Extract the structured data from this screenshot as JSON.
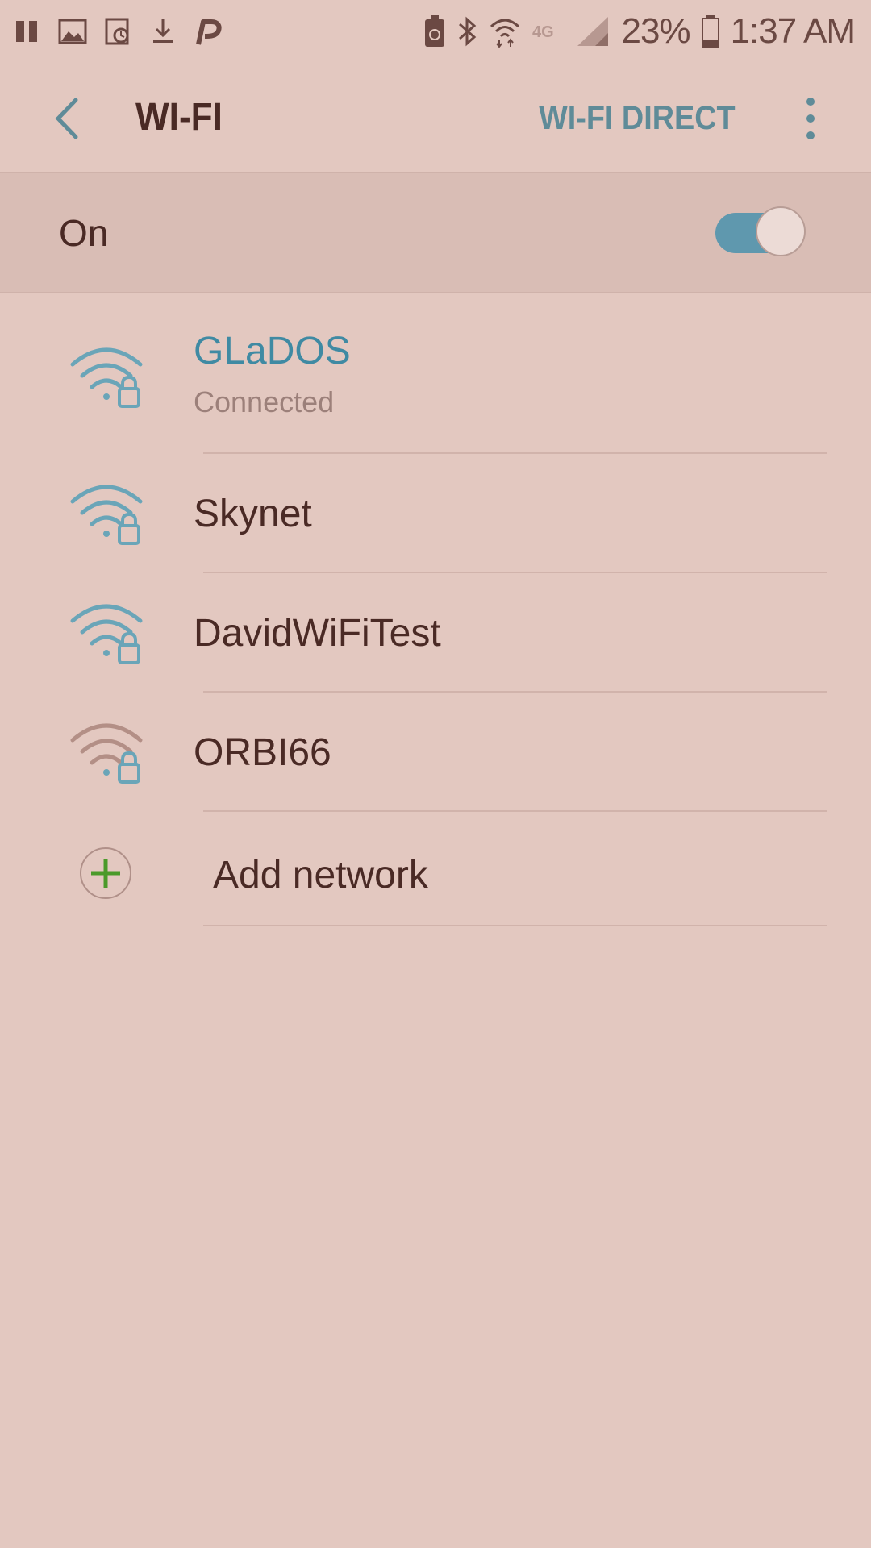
{
  "status_bar": {
    "left_icons": [
      "pause-icon",
      "gallery-icon",
      "sync-icon",
      "download-icon",
      "parking-icon"
    ],
    "right_icons": [
      "battery-saver-icon",
      "bluetooth-icon",
      "wifi-signal-icon",
      "4g-icon",
      "cell-signal-icon"
    ],
    "network_type": "4G",
    "battery_percent": "23%",
    "time": "1:37 AM"
  },
  "app_bar": {
    "back_icon": "chevron-left-icon",
    "title": "WI-FI",
    "wifi_direct_label": "WI-FI DIRECT",
    "more_icon": "vertical-dots-icon"
  },
  "toggle": {
    "label": "On",
    "state": true
  },
  "networks": [
    {
      "name": "GLaDOS",
      "status": "Connected",
      "connected": true,
      "secured": true,
      "signal": "strong",
      "icon": "wifi-lock-icon"
    },
    {
      "name": "Skynet",
      "status": "",
      "connected": false,
      "secured": true,
      "signal": "strong",
      "icon": "wifi-lock-icon"
    },
    {
      "name": "DavidWiFiTest",
      "status": "",
      "connected": false,
      "secured": true,
      "signal": "strong",
      "icon": "wifi-lock-icon"
    },
    {
      "name": "ORBI66",
      "status": "",
      "connected": false,
      "secured": true,
      "signal": "weak",
      "icon": "wifi-lock-icon"
    }
  ],
  "add_network": {
    "label": "Add network",
    "icon": "add-circle-icon"
  },
  "colors": {
    "background": "#e3c8c0",
    "accent": "#5f98ae",
    "connected_text": "#3f8aa3",
    "primary_text": "#4a2a25",
    "secondary_text": "#9c807a",
    "add_green": "#4b9a2a",
    "weak_signal": "#b38f86"
  }
}
